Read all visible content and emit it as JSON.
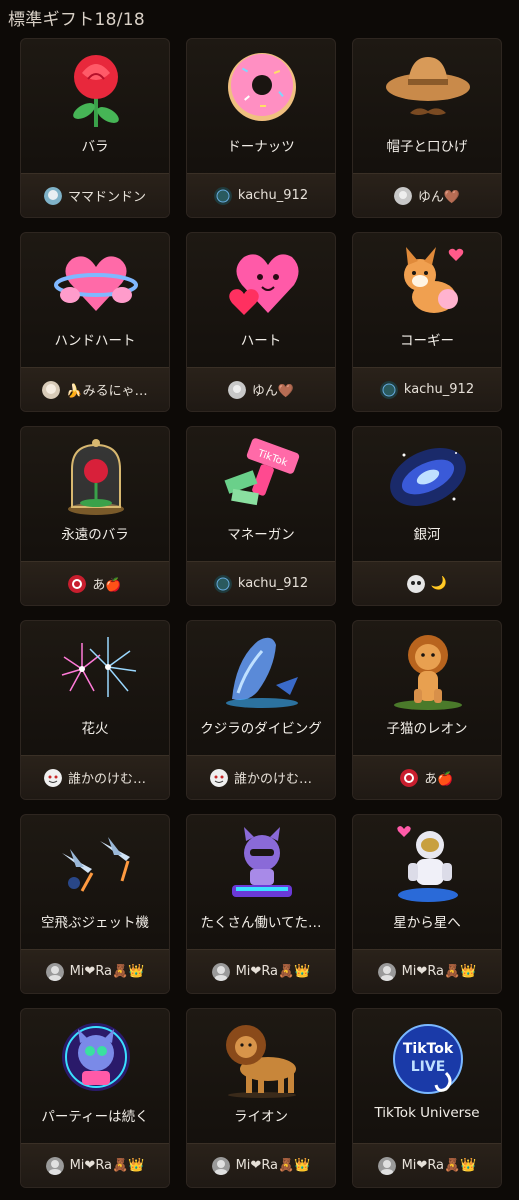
{
  "header": {
    "title": "標準ギフト18/18"
  },
  "gifts": [
    {
      "name": "バラ",
      "user": "ママドンドン",
      "icon": "rose-icon"
    },
    {
      "name": "ドーナッツ",
      "user": "kachu_912",
      "icon": "donut-icon"
    },
    {
      "name": "帽子と口ひげ",
      "user": "ゆん🤎",
      "icon": "hat-mustache-icon"
    },
    {
      "name": "ハンドハート",
      "user": "🍌みるにゃ…",
      "icon": "hand-heart-icon"
    },
    {
      "name": "ハート",
      "user": "ゆん🤎",
      "icon": "heart-icon"
    },
    {
      "name": "コーギー",
      "user": "kachu_912",
      "icon": "corgi-icon"
    },
    {
      "name": "永遠のバラ",
      "user": "あ🍎",
      "icon": "eternal-rose-icon"
    },
    {
      "name": "マネーガン",
      "user": "kachu_912",
      "icon": "money-gun-icon"
    },
    {
      "name": "銀河",
      "user": "🌙",
      "icon": "galaxy-icon"
    },
    {
      "name": "花火",
      "user": "誰かのけむ…",
      "icon": "fireworks-icon"
    },
    {
      "name": "クジラのダイビング",
      "user": "誰かのけむ…",
      "icon": "whale-icon"
    },
    {
      "name": "子猫のレオン",
      "user": "あ🍎",
      "icon": "lion-cub-icon"
    },
    {
      "name": "空飛ぶジェット機",
      "user": "Mi❤Ra🧸👑",
      "icon": "jet-icon"
    },
    {
      "name": "たくさん働いてた…",
      "user": "Mi❤Ra🧸👑",
      "icon": "dj-cat-icon"
    },
    {
      "name": "星から星へ",
      "user": "Mi❤Ra🧸👑",
      "icon": "astronaut-icon"
    },
    {
      "name": "パーティーは続く",
      "user": "Mi❤Ra🧸👑",
      "icon": "party-cat-icon"
    },
    {
      "name": "ライオン",
      "user": "Mi❤Ra🧸👑",
      "icon": "lion-icon"
    },
    {
      "name": "TikTok Universe",
      "user": "Mi❤Ra🧸👑",
      "icon": "tiktok-universe-icon"
    }
  ],
  "colors": {
    "background": "#0d0a07",
    "card": "#1a1511",
    "footer": "#261f18",
    "border": "#3a3026"
  }
}
